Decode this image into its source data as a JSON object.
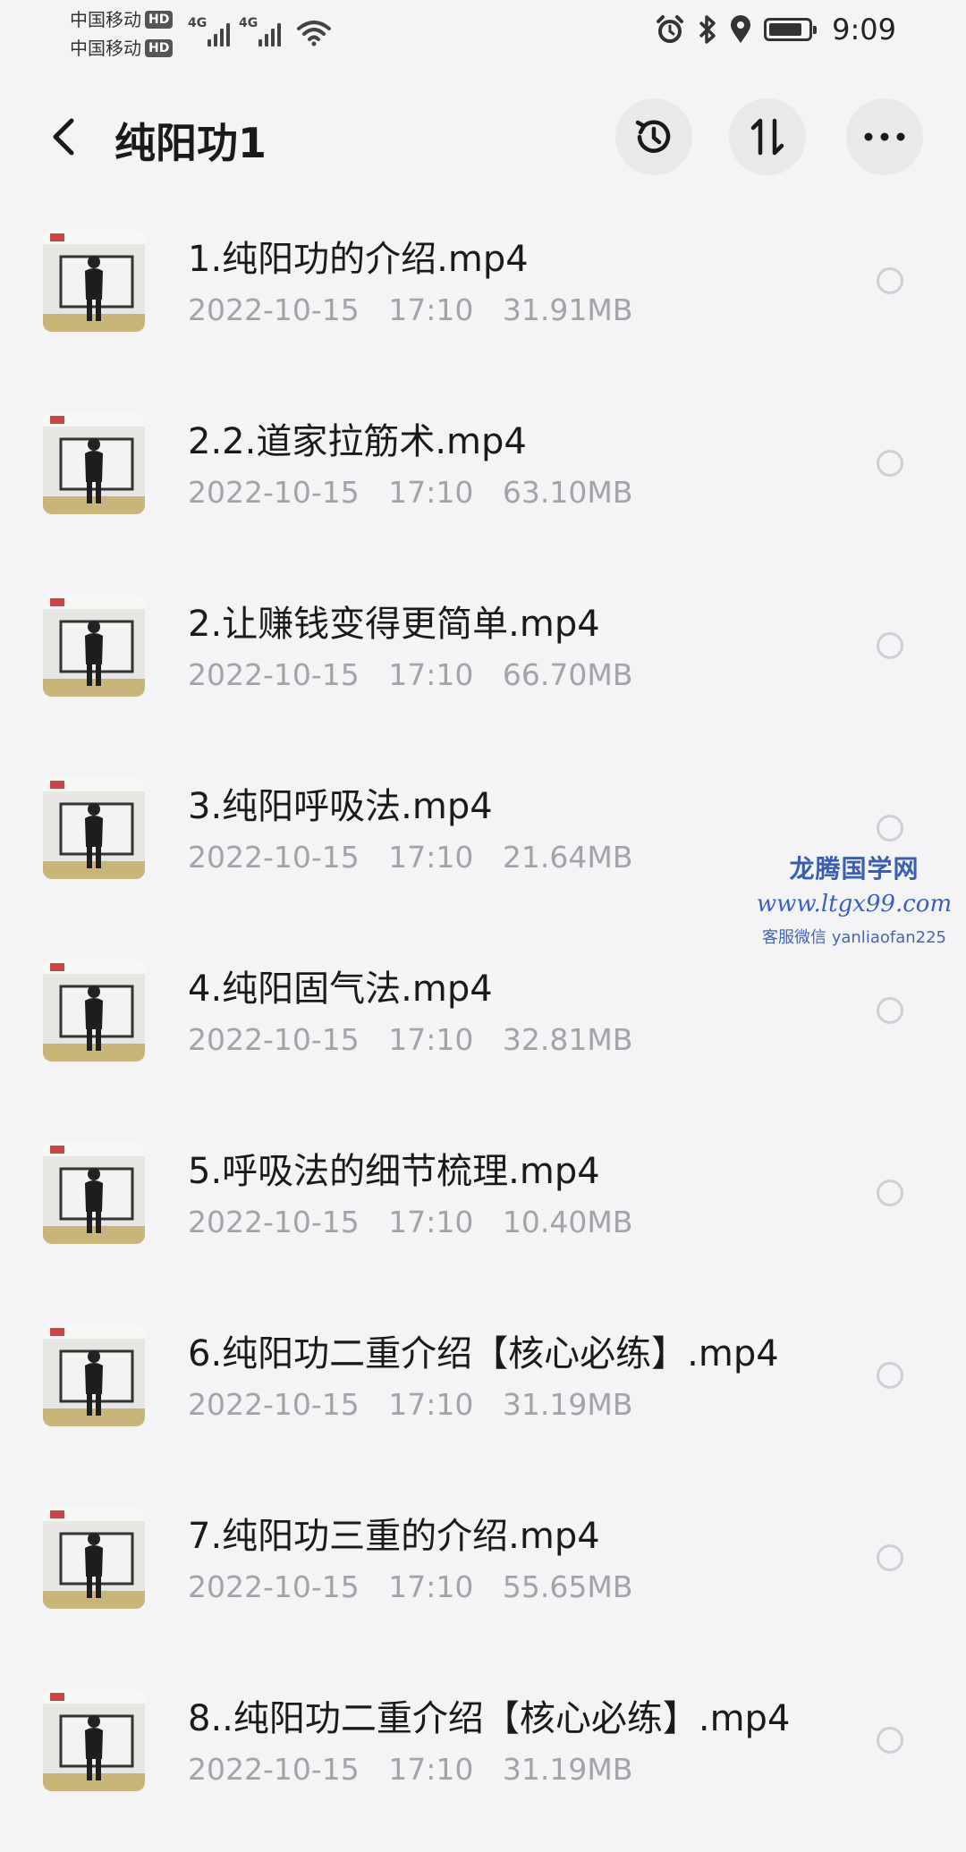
{
  "status_bar": {
    "carrier1": "中国移动",
    "carrier2": "中国移动",
    "hd_badge": "HD",
    "network": "4G",
    "time": "9:09",
    "battery_level": 0.85,
    "icons": [
      "alarm-icon",
      "bluetooth-icon",
      "location-icon",
      "battery-icon"
    ]
  },
  "header": {
    "title": "纯阳功1",
    "buttons": [
      "back-icon",
      "history-icon",
      "sort-icon",
      "more-icon"
    ]
  },
  "files": [
    {
      "name": "1.纯阳功的介绍.mp4",
      "date": "2022-10-15",
      "time": "17:10",
      "size": "31.91MB"
    },
    {
      "name": "2.2.道家拉筋术.mp4",
      "date": "2022-10-15",
      "time": "17:10",
      "size": "63.10MB"
    },
    {
      "name": "2.让赚钱变得更简单.mp4",
      "date": "2022-10-15",
      "time": "17:10",
      "size": "66.70MB"
    },
    {
      "name": "3.纯阳呼吸法.mp4",
      "date": "2022-10-15",
      "time": "17:10",
      "size": "21.64MB"
    },
    {
      "name": "4.纯阳固气法.mp4",
      "date": "2022-10-15",
      "time": "17:10",
      "size": "32.81MB"
    },
    {
      "name": "5.呼吸法的细节梳理.mp4",
      "date": "2022-10-15",
      "time": "17:10",
      "size": "10.40MB"
    },
    {
      "name": "6.纯阳功二重介绍【核心必练】.mp4",
      "date": "2022-10-15",
      "time": "17:10",
      "size": "31.19MB"
    },
    {
      "name": "7.纯阳功三重的介绍.mp4",
      "date": "2022-10-15",
      "time": "17:10",
      "size": "55.65MB"
    },
    {
      "name": "8..纯阳功二重介绍【核心必练】.mp4",
      "date": "2022-10-15",
      "time": "17:10",
      "size": "31.19MB"
    }
  ],
  "watermark": {
    "title": "龙腾国学网",
    "url": "www.ltgx99.com",
    "contact": "客服微信 yanliaofan225"
  },
  "colors": {
    "background": "#f4f4f6",
    "title_text": "#1a1a1a",
    "meta_text": "#a4a4a8",
    "watermark": "#3a5fb0"
  }
}
